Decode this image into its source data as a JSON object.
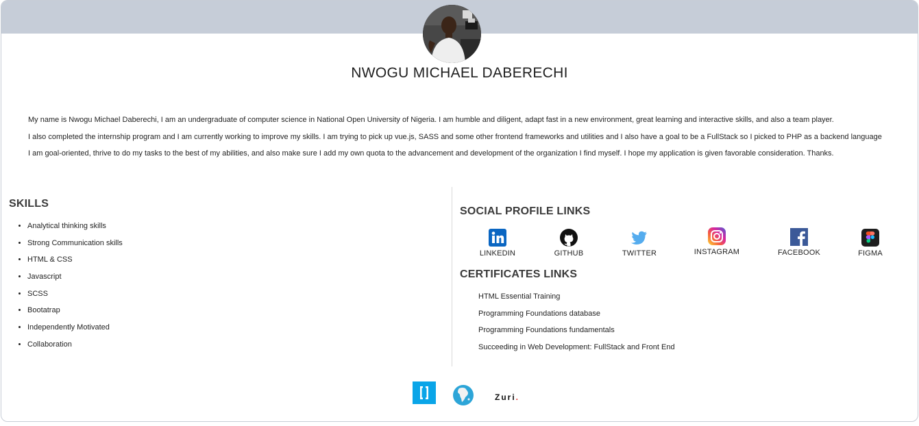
{
  "profile": {
    "name": "NWOGU MICHAEL DABERECHI",
    "bio": [
      "My name is Nwogu Michael Daberechi, I am an undergraduate of computer science in National Open University of Nigeria. I am humble and diligent, adapt fast in a new environment, great learning and interactive skills, and also a team player.",
      "I also completed the internship program and I am currently working to improve my skills. I am trying to pick up vue.js, SASS and some other frontend frameworks and utilities and I also have a goal to be a FullStack so I picked to PHP as a backend language",
      "I am goal-oriented, thrive to do my tasks to the best of my abilities, and also make sure I add my own quota to the advancement and development of the organization I find myself. I hope my application is given favorable consideration. Thanks."
    ]
  },
  "skills": {
    "title": "SKILLS",
    "items": [
      "Analytical thinking skills",
      "Strong Communication skills",
      "HTML & CSS",
      "Javascript",
      "SCSS",
      "Bootatrap",
      "Independently Motivated",
      "Collaboration"
    ]
  },
  "social": {
    "title": "SOCIAL PROFILE LINKS",
    "links": [
      {
        "label": "LINKEDIN",
        "icon": "linkedin-icon",
        "color": "#0a66c2"
      },
      {
        "label": "GITHUB",
        "icon": "github-icon",
        "color": "#111111"
      },
      {
        "label": "TWITTER",
        "icon": "twitter-icon",
        "color": "#55acee"
      },
      {
        "label": "INSTAGRAM",
        "icon": "instagram-icon",
        "color": "#d6249f"
      },
      {
        "label": "FACEBOOK",
        "icon": "facebook-icon",
        "color": "#3b5998"
      },
      {
        "label": "FIGMA",
        "icon": "figma-icon",
        "color": "#1e1e1e"
      }
    ]
  },
  "certificates": {
    "title": "CERTIFICATES LINKS",
    "items": [
      "HTML Essential Training",
      "Programming Foundations database",
      "Programming Foundations fundamentals",
      "Succeeding in Web Development: FullStack and Front End"
    ]
  },
  "footer": {
    "zuri_text": "Zuri",
    "zuri_dot": ".",
    "logos": [
      "i4g-logo",
      "ingressive-globe-logo",
      "zuri-logo"
    ]
  },
  "colors": {
    "banner": "#c6cdd8",
    "text": "#222222",
    "heading": "#3a3a3a",
    "i4g_blue": "#0aa5e8",
    "zuri_dot": "#e0312b"
  }
}
